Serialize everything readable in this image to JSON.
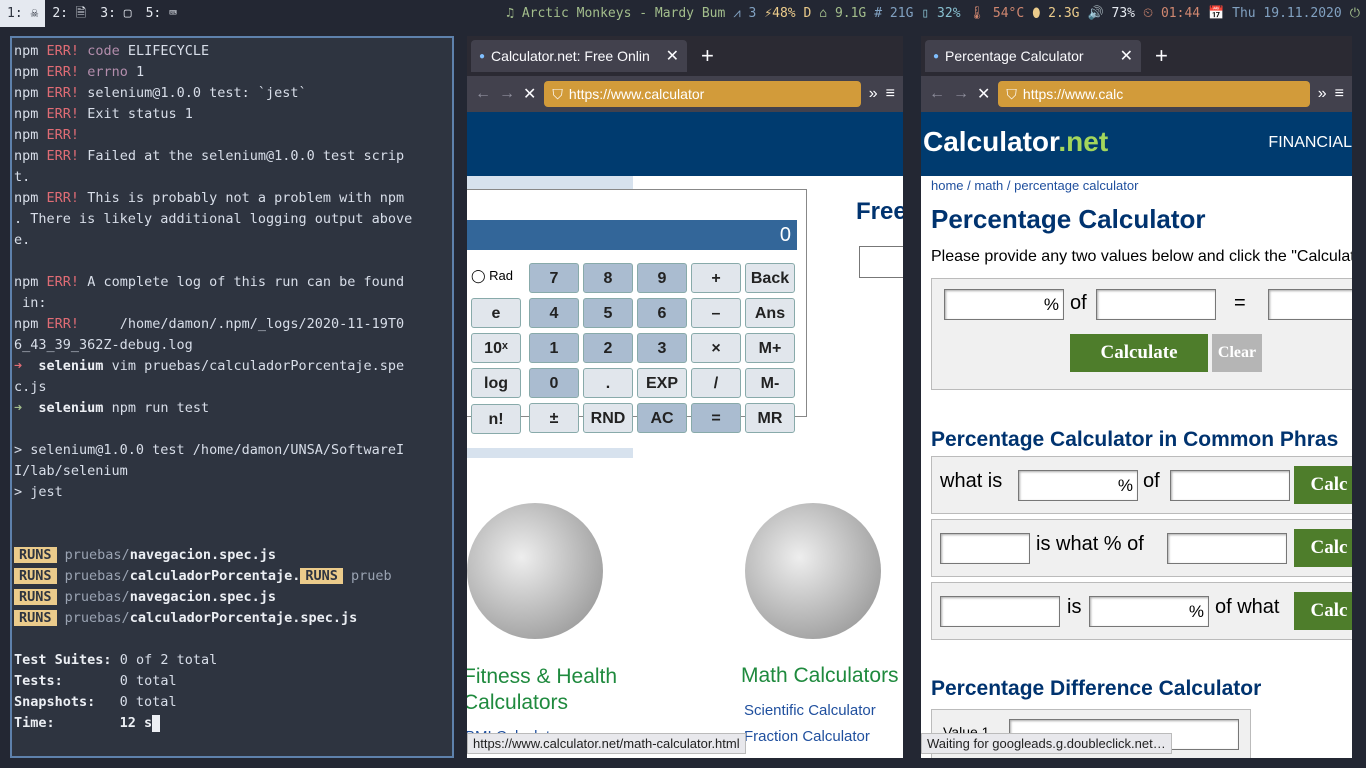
{
  "bar": {
    "workspaces": [
      {
        "label": "1: ☠"
      },
      {
        "label": "2: 🗎"
      },
      {
        "label": "3: ▢"
      },
      {
        "label": "5: ⌨"
      }
    ],
    "music": "♫ Arctic Monkeys - Mardy Bum",
    "arch": "⩘ 3",
    "battery": "⚡48% D",
    "home": "⌂ 9.1G",
    "root": "# 21G",
    "cpu": "▯ 32%",
    "temp": "🌡 54°C",
    "mem": "⬮ 2.3G",
    "volume": "🔊 73%",
    "clock": "⏲ 01:44",
    "date": "📅 Thu 19.11.2020",
    "power": "⏻"
  },
  "terminal": {
    "npm": "npm",
    "err": "ERR!",
    "l1k": "code",
    "l1v": "ELIFECYCLE",
    "l2k": "errno",
    "l2v": "1",
    "l3": "selenium@1.0.0 test: `jest`",
    "l4": "Exit status 1",
    "l6": "Failed at the selenium@1.0.0 test scrip",
    "l6b": "t.",
    "l7": "This is probably not a problem with npm",
    "l7b": ". There is likely additional logging output above",
    "l7c": "e.",
    "l8": "A complete log of this run can be found",
    "l8b": " in:",
    "l9": "    /home/damon/.npm/_logs/2020-11-19T0",
    "l9b": "6_43_39_362Z-debug.log",
    "arrow": "➜",
    "dir": "selenium",
    "cmd1": "vim pruebas/calculadorPorcentaje.spe",
    "cmd1b": "c.js",
    "cmd2": "npm run test",
    "o1": "> selenium@1.0.0 test /home/damon/UNSA/SoftwareI",
    "o1b": "I/lab/selenium",
    "o2": "> jest",
    "runs": "RUNS",
    "pdir": "pruebas/",
    "f1": "navegacion.spec.js",
    "f2": "calculadorPorcentaje.",
    "f2c": "prueb",
    "f4": "calculadorPorcentaje.spec.js",
    "s1k": "Test Suites:",
    "s1v": "0 of 2 total",
    "s2k": "Tests:",
    "s2v": "0 total",
    "s3k": "Snapshots:",
    "s3v": "0 total",
    "s4k": "Time:",
    "s4v": "12 s"
  },
  "win1": {
    "tab": "Calculator.net: Free Onlin",
    "url": "https://www.calculator",
    "status": "https://www.calculator.net/math-calculator.html",
    "display": "0",
    "rad": "Rad",
    "free": "Free",
    "keys": [
      [
        "7",
        "8",
        "9",
        "+",
        "Back"
      ],
      [
        "4",
        "5",
        "6",
        "–",
        "Ans"
      ],
      [
        "1",
        "2",
        "3",
        "×",
        "M+"
      ],
      [
        "0",
        ".",
        "EXP",
        "/",
        "M-"
      ],
      [
        "±",
        "RND",
        "AC",
        "=",
        "MR"
      ]
    ],
    "sci": [
      "e",
      "10ˣ",
      "log",
      "n!"
    ],
    "sec1": "Fitness & Health",
    "sec1b": "Calculators",
    "sec2": "Math Calculators",
    "link1": "BMI Calculator",
    "link2": "Scientific Calculator",
    "link3": "Fraction Calculator"
  },
  "win2": {
    "tab": "Percentage Calculator",
    "url": "https://www.calc",
    "status": "Waiting for googleads.g.doubleclick.net…",
    "logo1": "Calculator",
    "logo2": ".net",
    "nav": "FINANCIAL",
    "crumb1": "home",
    "crumb2": "math",
    "crumb3": "percentage calculator",
    "sep": " / ",
    "title": "Percentage Calculator",
    "intro": "Please provide any two values below and click the \"Calculat",
    "pct": "%",
    "of": "of",
    "eq": "=",
    "calc": "Calculate",
    "clear": "Clear",
    "h2": "Percentage Calculator in Common Phras",
    "p1": "what is",
    "p2": "is what % of",
    "p3a": "is",
    "p3b": "of what",
    "calcs": "Calc",
    "h3": "Percentage Difference Calculator",
    "v1": "Value 1"
  }
}
